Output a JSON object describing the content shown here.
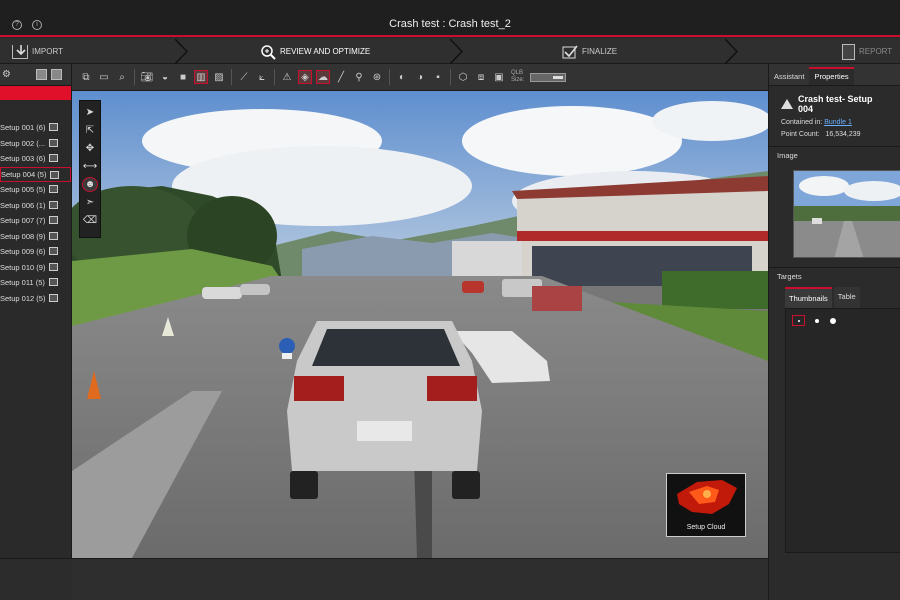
{
  "window": {
    "title": "Crash test : Crash test_2",
    "help_icon": "question-icon",
    "info_icon": "info-icon"
  },
  "workflow": {
    "steps": [
      {
        "label": "IMPORT",
        "icon": "import-icon"
      },
      {
        "label": "REVIEW AND OPTIMIZE",
        "icon": "review-zoom-icon"
      },
      {
        "label": "FINALIZE",
        "icon": "finalize-check-icon"
      },
      {
        "label": "REPORT",
        "icon": "report-icon"
      }
    ],
    "active_index": 1,
    "accent_color": "#c8102e"
  },
  "setups": {
    "items": [
      {
        "label": "Setup 001 (6)"
      },
      {
        "label": "Setup 002 (..."
      },
      {
        "label": "Setup 003 (6)"
      },
      {
        "label": "Setup 004 (5)"
      },
      {
        "label": "Setup 005 (5)"
      },
      {
        "label": "Setup 006 (1)"
      },
      {
        "label": "Setup 007 (7)"
      },
      {
        "label": "Setup 008 (9)"
      },
      {
        "label": "Setup 009 (6)"
      },
      {
        "label": "Setup 010 (9)"
      },
      {
        "label": "Setup 011 (5)"
      },
      {
        "label": "Setup 012 (5)"
      }
    ],
    "selected_index": 3
  },
  "toolbar": {
    "qlb_label": "QLB",
    "size_label": "Size:"
  },
  "viewport": {
    "setup_cloud_caption": "Setup Cloud"
  },
  "right_panel": {
    "tabs": [
      "Assistant",
      "Properties"
    ],
    "active_tab": "Properties",
    "title": "Crash test- Setup 004",
    "contained_in_label": "Contained in:",
    "contained_in_value": "Bundle 1",
    "point_count_label": "Point Count:",
    "point_count_value": "16,534,239",
    "image_section": "Image",
    "targets_section": "Targets",
    "targets_tabs": [
      "Thumbnails",
      "Table"
    ],
    "active_targets_tab": "Thumbnails"
  }
}
